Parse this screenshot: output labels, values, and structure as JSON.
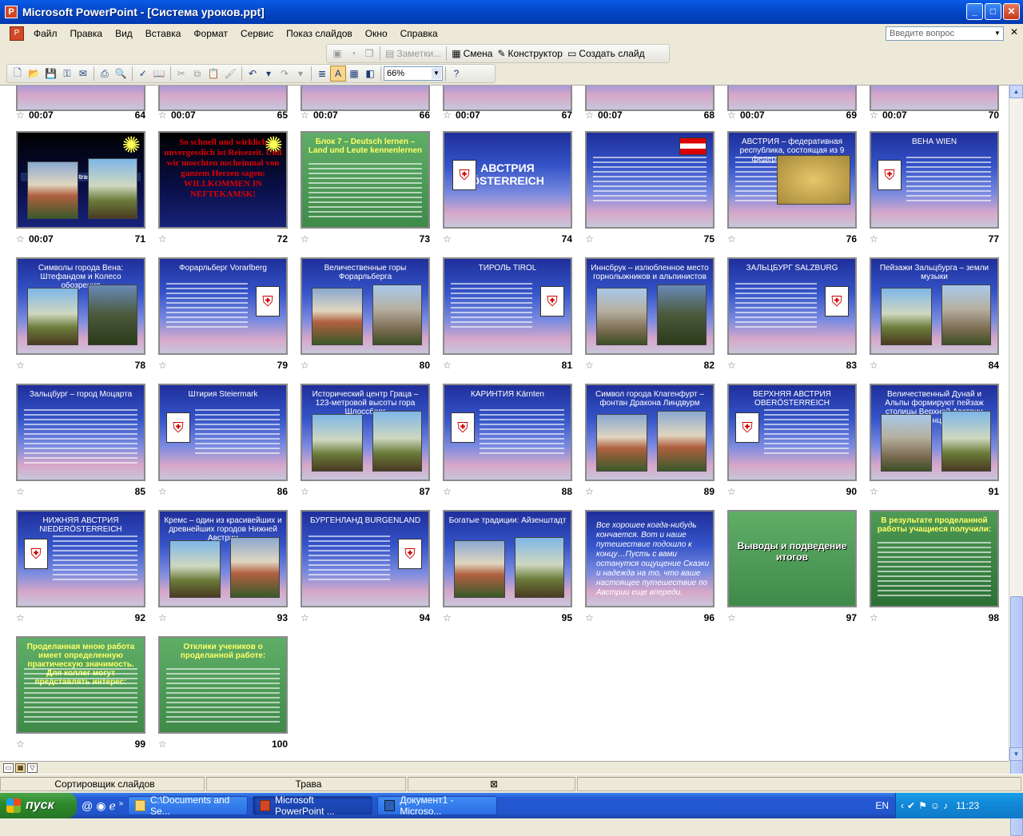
{
  "window": {
    "title": "Microsoft PowerPoint - [Система уроков.ppt]"
  },
  "menu": {
    "items": [
      "Файл",
      "Правка",
      "Вид",
      "Вставка",
      "Формат",
      "Сервис",
      "Показ слайдов",
      "Окно",
      "Справка"
    ],
    "help_placeholder": "Введите вопрос"
  },
  "toolbar_sorter": {
    "notes": "Заметки...",
    "transition": "Смена",
    "designer": "Конструктор",
    "new_slide": "Создать слайд"
  },
  "toolbar_std": {
    "zoom": "66%"
  },
  "slides": [
    {
      "num": "64",
      "time": "00:07"
    },
    {
      "num": "65",
      "time": "00:07"
    },
    {
      "num": "66",
      "time": "00:07"
    },
    {
      "num": "67",
      "time": "00:07"
    },
    {
      "num": "68",
      "time": "00:07"
    },
    {
      "num": "69",
      "time": "00:07"
    },
    {
      "num": "70",
      "time": "00:07"
    },
    {
      "num": "71",
      "time": "00:07",
      "title": "Die modernen Strassen der Stadt"
    },
    {
      "num": "72",
      "title": "So schnell und wirklich unvergesslich ist Reisezeit. Und wir moechten nocheinmal von ganzem Herzen sagen: WILLKOMMEN IN NEFTEKAMSK!"
    },
    {
      "num": "73",
      "title": "Блок 7 – Deutsch lernen – Land und Leute kennenlernen"
    },
    {
      "num": "74",
      "title": "АВСТРИЯ ÖSTERREICH"
    },
    {
      "num": "75"
    },
    {
      "num": "76",
      "title": "АВСТРИЯ – федеративная республика, состоящая из 9 федеральных земель"
    },
    {
      "num": "77",
      "title": "ВЕНА WIEN"
    },
    {
      "num": "78",
      "title": "Символы города Вена: Штефандом и Колесо обозрения"
    },
    {
      "num": "79",
      "title": "Форарльберг Vorarlberg"
    },
    {
      "num": "80",
      "title": "Величественные горы Форарльберга"
    },
    {
      "num": "81",
      "title": "ТИРОЛЬ TIROL"
    },
    {
      "num": "82",
      "title": "Иннсбрук – излюбленное место горнолыжников и альпинистов"
    },
    {
      "num": "83",
      "title": "ЗАЛЬЦБУРГ SALZBURG"
    },
    {
      "num": "84",
      "title": "Пейзажи Зальцбурга – земли музыки"
    },
    {
      "num": "85",
      "title": "Зальцбург – город Моцарта"
    },
    {
      "num": "86",
      "title": "Штирия Steiermark"
    },
    {
      "num": "87",
      "title": "Исторический центр Граца – 123-метровой высоты гора Шлоссберг"
    },
    {
      "num": "88",
      "title": "КАРИНТИЯ Kärnten"
    },
    {
      "num": "89",
      "title": "Символ города Клагенфурт – фонтан Дракона Линдвурм"
    },
    {
      "num": "90",
      "title": "ВЕРХНЯЯ АВСТРИЯ OBERÖSTERREICH"
    },
    {
      "num": "91",
      "title": "Величественный Дунай и Альпы формируют пейзаж столицы Верхней Австрии Линца"
    },
    {
      "num": "92",
      "title": "НИЖНЯЯ АВСТРИЯ NIEDERÖSTERREICH"
    },
    {
      "num": "93",
      "title": "Кремс – один из красивейших и древнейших городов Нижней Австрии"
    },
    {
      "num": "94",
      "title": "БУРГЕНЛАНД BURGENLAND"
    },
    {
      "num": "95",
      "title": "Богатые традиции: Айзенштадт"
    },
    {
      "num": "96",
      "title": "Все хорошее когда-нибудь кончается. Вот и наше путешествие подошло к концу…Пусть с вами останутся ощущение Сказки и надежда на то, что ваше настоящее путешествие по Австрии еще впереди."
    },
    {
      "num": "97",
      "title": "Выводы и подведение итогов"
    },
    {
      "num": "98",
      "title": "В результате проделанной работы учащиеся получили:"
    },
    {
      "num": "99",
      "title": "Проделанная мною работа имеет определенную практическую значимость. Для коллег могут представлять интерес:"
    },
    {
      "num": "100",
      "title": "Отклики учеников о проделанной работе:"
    }
  ],
  "status": {
    "view": "Сортировщик слайдов",
    "design": "Трава"
  },
  "taskbar": {
    "start": "пуск",
    "tasks": [
      "C:\\Documents and Se...",
      "Microsoft PowerPoint ...",
      "Документ1 - Microso..."
    ],
    "lang": "EN",
    "clock": "11:23"
  }
}
